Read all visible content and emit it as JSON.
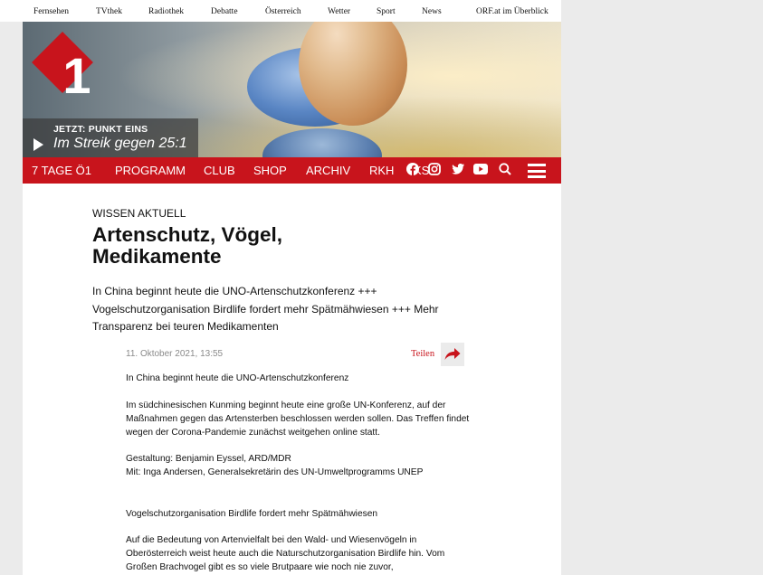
{
  "orf_nav": {
    "items": [
      "Fernsehen",
      "TVthek",
      "Radiothek",
      "Debatte",
      "Österreich",
      "Wetter",
      "Sport",
      "News",
      "ORF.at im Überblick"
    ]
  },
  "header": {
    "logo": "ö1-logo",
    "now_label": "JETZT: PUNKT EINS",
    "now_title": "Im Streik gegen 25:1"
  },
  "main_nav": {
    "items": [
      "7 TAGE Ö1",
      "PROGRAMM",
      "CLUB",
      "SHOP",
      "ARCHIV",
      "RKH"
    ],
    "truncated_item": "KS",
    "icons": [
      "facebook-icon",
      "instagram-icon",
      "twitter-icon",
      "youtube-icon",
      "search-icon",
      "menu-icon"
    ]
  },
  "article": {
    "kicker": "WISSEN AKTUELL",
    "title": "Artenschutz, Vögel, Medikamente",
    "lead": "In China beginnt heute die UNO-Artenschutzkonferenz +++ Vogelschutzorganisation Birdlife fordert mehr Spätmähwiesen +++ Mehr Transparenz bei teuren Medikamenten",
    "date": "11. Oktober 2021, 13:55",
    "share_label": "Teilen",
    "paragraphs": [
      "In China beginnt heute die UNO-Artenschutzkonferenz",
      "Im südchinesischen Kunming beginnt heute eine große UN-Konferenz, auf der Maßnahmen gegen das Artensterben beschlossen werden sollen. Das Treffen findet wegen der Corona-Pandemie zunächst weitgehen online statt.",
      "Gestaltung: Benjamin Eyssel, ARD/MDR",
      "Mit: Inga Andersen, Generalsekretärin des UN-Umweltprogramms UNEP",
      "Vogelschutzorganisation Birdlife fordert mehr Spätmähwiesen",
      "Auf die Bedeutung von Artenvielfalt bei den Wald- und Wiesenvögeln in Oberösterreich weist heute auch die Naturschutzorganisation Birdlife hin. Vom Großen Brachvogel gibt es so viele Brutpaare wie noch nie zuvor,"
    ]
  },
  "colors": {
    "brand_red": "#c8141c",
    "page_bg": "#ebebeb",
    "content_bg": "#ffffff",
    "date_grey": "#8a8a8a"
  }
}
